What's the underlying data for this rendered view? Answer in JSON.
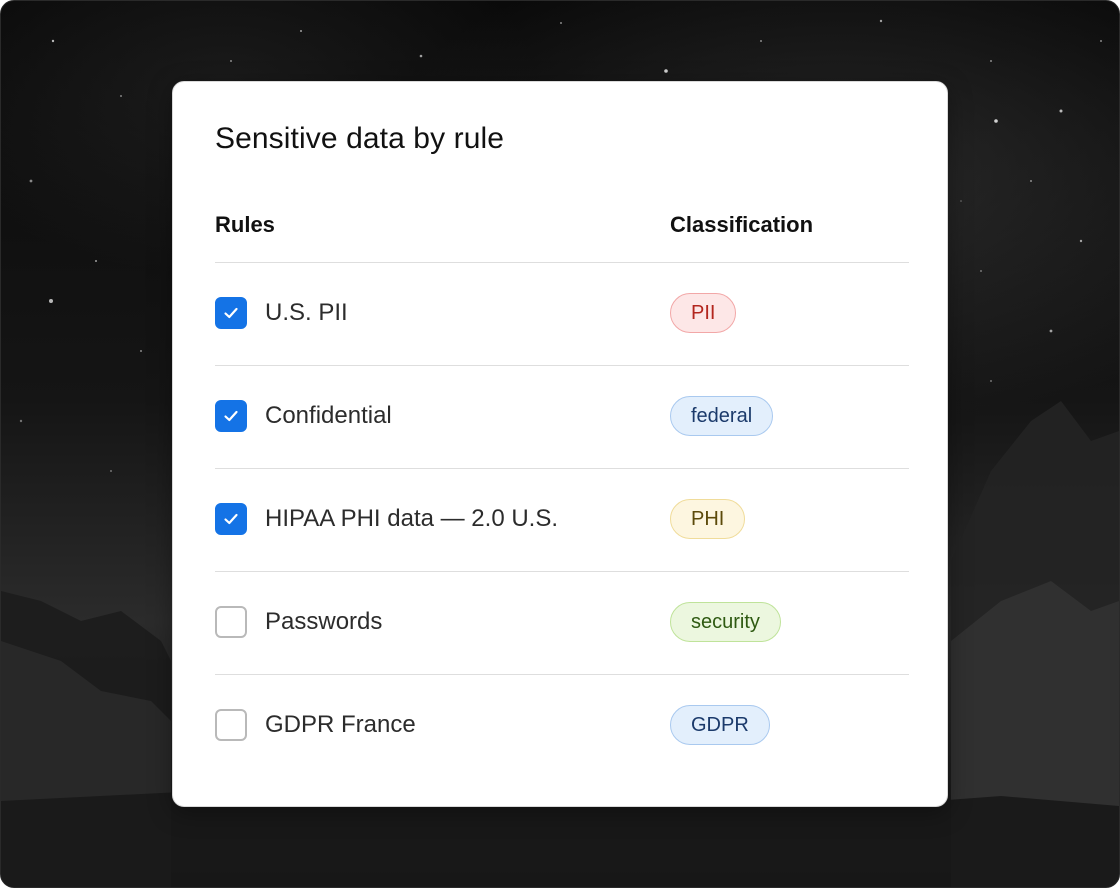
{
  "card": {
    "title": "Sensitive data by rule"
  },
  "table": {
    "headers": {
      "rules": "Rules",
      "classification": "Classification"
    },
    "rows": [
      {
        "rule": "U.S. PII",
        "checked": true,
        "classification": "PII",
        "badge_colors": {
          "bg": "#fde7e7",
          "border": "#f2a7a7",
          "text": "#b3261e"
        }
      },
      {
        "rule": "Confidential",
        "checked": true,
        "classification": "federal",
        "badge_colors": {
          "bg": "#e3effc",
          "border": "#a9c9ef",
          "text": "#1b3a6b"
        }
      },
      {
        "rule": "HIPAA PHI data — 2.0 U.S.",
        "checked": true,
        "classification": "PHI",
        "badge_colors": {
          "bg": "#fdf6e0",
          "border": "#f0dc9a",
          "text": "#5c4a0a"
        }
      },
      {
        "rule": "Passwords",
        "checked": false,
        "classification": "security",
        "badge_colors": {
          "bg": "#ecf7df",
          "border": "#bfe39a",
          "text": "#2f5a12"
        }
      },
      {
        "rule": "GDPR France",
        "checked": false,
        "classification": "GDPR",
        "badge_colors": {
          "bg": "#e3effc",
          "border": "#a9c9ef",
          "text": "#1b3a6b"
        }
      }
    ]
  },
  "colors": {
    "checkbox_checked": "#1473e6",
    "checkbox_unchecked_border": "#b9b9b9",
    "divider": "#dedede"
  },
  "icons": {
    "check": "checkmark-icon"
  }
}
